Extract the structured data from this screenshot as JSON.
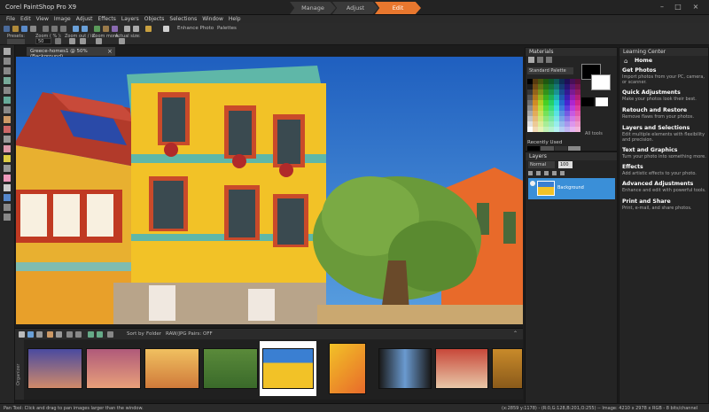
{
  "app": {
    "title": "Corel PaintShop Pro X9"
  },
  "workspace_tabs": [
    "Manage",
    "Adjust",
    "Edit"
  ],
  "active_tab": "Edit",
  "menu": [
    "File",
    "Edit",
    "View",
    "Image",
    "Adjust",
    "Effects",
    "Layers",
    "Objects",
    "Selections",
    "Window",
    "Help"
  ],
  "toolbar": {
    "presets_label": "Presets:",
    "zoom_label": "Zoom ( % ):",
    "zoom_value": "50",
    "zoom_outin_label": "Zoom out / in:",
    "zoom_more_label": "Zoom more:",
    "actual_size_label": "Actual size:",
    "enhance_photo": "Enhance Photo",
    "palettes": "Palettes"
  },
  "document": {
    "tab_label": "Greece-homes1 @ 50% (Background)"
  },
  "organizer": {
    "sort_by_label": "Sort by",
    "sort_value": "Folder",
    "raw_pairs": "RAW/JPG Pairs: OFF",
    "side_label": "Organizer"
  },
  "status": {
    "left": "Pan Tool: Click and drag to pan images larger than the window.",
    "right": "(x:2859 y:1178) - (R:0,G:128,B:201,O:255)  --  Image: 4210 x 2978 x RGB - 8 bits/channel"
  },
  "materials": {
    "title": "Materials",
    "palette_select": "Standard Palette",
    "recently_used": "Recently Used",
    "all_tools": "All tools"
  },
  "layers": {
    "title": "Layers",
    "blend_mode": "Normal",
    "opacity": "100",
    "layer_name": "Background"
  },
  "learning_center": {
    "title": "Learning Center",
    "home": "Home",
    "items": [
      {
        "title": "Get Photos",
        "desc": "Import photos from your PC, camera, or scanner."
      },
      {
        "title": "Quick Adjustments",
        "desc": "Make your photos look their best."
      },
      {
        "title": "Retouch and Restore",
        "desc": "Remove flaws from your photos."
      },
      {
        "title": "Layers and Selections",
        "desc": "Edit multiple elements with flexibility and precision."
      },
      {
        "title": "Text and Graphics",
        "desc": "Turn your photo into something more."
      },
      {
        "title": "Effects",
        "desc": "Add artistic effects to your photo."
      },
      {
        "title": "Advanced Adjustments",
        "desc": "Enhance and edit with powerful tools."
      },
      {
        "title": "Print and Share",
        "desc": "Print, e-mail, and share photos."
      }
    ]
  },
  "colors": {
    "accent": "#e8772e",
    "panel_bg": "#242424",
    "layer_selected": "#3a8fd8",
    "sky": "#3a7fd2",
    "wall_yellow": "#f2c227",
    "trim_red": "#c94a2a",
    "wall_orange": "#e86a2a",
    "trim_teal": "#5fb7a8"
  }
}
